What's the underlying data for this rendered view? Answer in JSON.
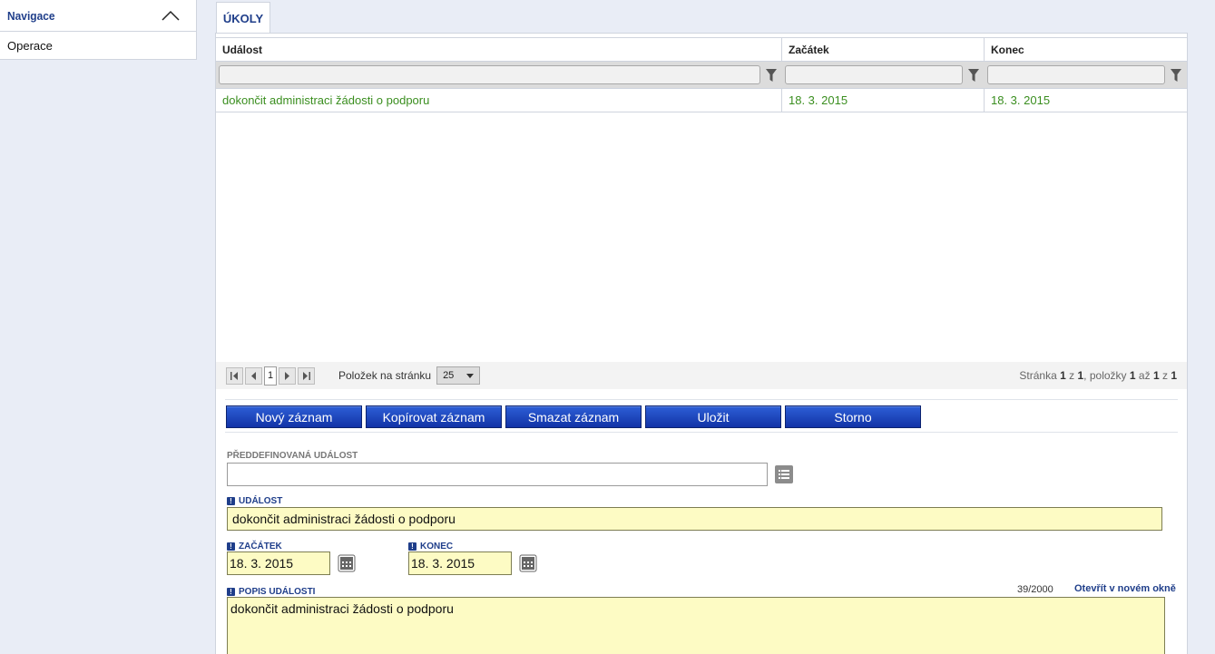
{
  "sidebar": {
    "title": "Navigace",
    "items": [
      {
        "label": "Operace"
      }
    ]
  },
  "tab": {
    "label": "ÚKOLY"
  },
  "grid": {
    "columns": [
      "Událost",
      "Začátek",
      "Konec"
    ],
    "rows": [
      {
        "event": "dokončit administraci žádosti o podporu",
        "start": "18. 3. 2015",
        "end": "18. 3. 2015"
      }
    ]
  },
  "pager": {
    "current_page": "1",
    "per_page_label": "Položek na stránku",
    "per_page_value": "25",
    "info_prefix": "Stránka",
    "page": "1",
    "of": "z",
    "pages": "1",
    "items_label": ", položky",
    "from": "1",
    "to_label": "až",
    "to": "1",
    "of2": "z",
    "total": "1"
  },
  "buttons": {
    "new": "Nový záznam",
    "copy": "Kopírovat záznam",
    "delete": "Smazat záznam",
    "save": "Uložit",
    "cancel": "Storno"
  },
  "form": {
    "predefined_label": "PŘEDDEFINOVANÁ UDÁLOST",
    "predefined_value": "",
    "event_label": "UDÁLOST",
    "event_value": "dokončit administraci žádosti o podporu",
    "start_label": "ZAČÁTEK",
    "start_value": "18. 3. 2015",
    "end_label": "KONEC",
    "end_value": "18. 3. 2015",
    "desc_label": "POPIS UDÁLOSTI",
    "desc_counter": "39/2000",
    "desc_open_link": "Otevřít v novém okně",
    "desc_value": "dokončit administraci žádosti o podporu"
  },
  "colors": {
    "accent": "#1f3e8a",
    "row_text": "#3a8e1f",
    "required_field_bg": "#fdfbc4",
    "button_bg": "#1f45c0"
  },
  "icons": {
    "collapse": "chevron-up-icon",
    "filter": "funnel-icon",
    "list": "list-icon",
    "calendar": "calendar-icon",
    "required": "exclamation-icon"
  }
}
